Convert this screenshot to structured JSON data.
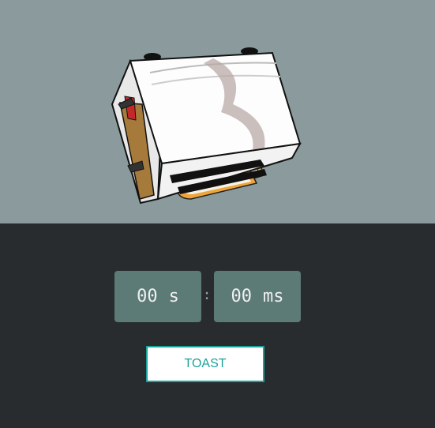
{
  "illustration": {
    "icon": "toaster-illustration"
  },
  "timer": {
    "seconds_value": "00",
    "seconds_unit": "s",
    "separator": ":",
    "ms_value": "00",
    "ms_unit": "ms"
  },
  "actions": {
    "toast_label": "TOAST"
  },
  "colors": {
    "top_background": "#8b9a9c",
    "bottom_background": "#282c2e",
    "timer_box": "#5c7a76",
    "accent": "#1aa39a"
  }
}
